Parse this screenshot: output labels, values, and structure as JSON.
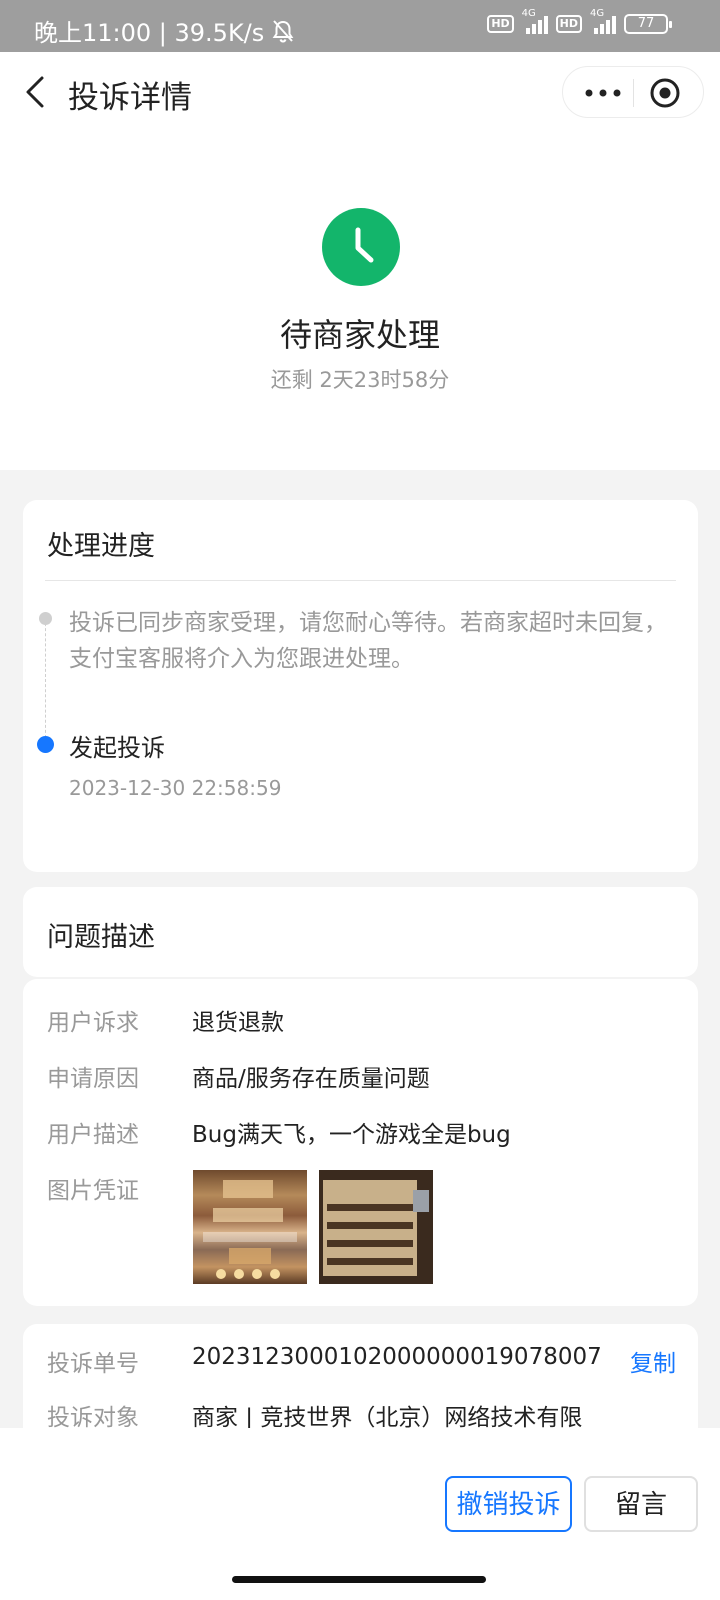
{
  "status_bar": {
    "time_speed": "晚上11:00 | 39.5K/s",
    "hd1": "HD",
    "net1": "4G",
    "hd2": "HD",
    "net2": "4G",
    "battery": "77"
  },
  "nav": {
    "title": "投诉详情"
  },
  "hero": {
    "status": "待商家处理",
    "remaining": "还剩 2天23时58分"
  },
  "progress": {
    "title": "处理进度",
    "step1_text": "投诉已同步商家受理，请您耐心等待。若商家超时未回复，支付宝客服将介入为您跟进处理。",
    "step2_title": "发起投诉",
    "step2_time": "2023-12-30 22:58:59"
  },
  "description": {
    "title": "问题描述",
    "rows": [
      {
        "label": "用户诉求",
        "value": "退货退款"
      },
      {
        "label": "申请原因",
        "value": "商品/服务存在质量问题"
      },
      {
        "label": "用户描述",
        "value": "Bug满天飞，一个游戏全是bug"
      },
      {
        "label": "图片凭证",
        "value": ""
      }
    ]
  },
  "order": {
    "number_label": "投诉单号",
    "number_value": "2023123000102000000019078007",
    "copy_label": "复制",
    "target_label": "投诉对象",
    "target_value": "商家 | 竞技世界（北京）网络技术有限"
  },
  "actions": {
    "revoke": "撤销投诉",
    "message": "留言"
  },
  "colors": {
    "accent": "#1677ff",
    "status_green": "#13b56b"
  }
}
